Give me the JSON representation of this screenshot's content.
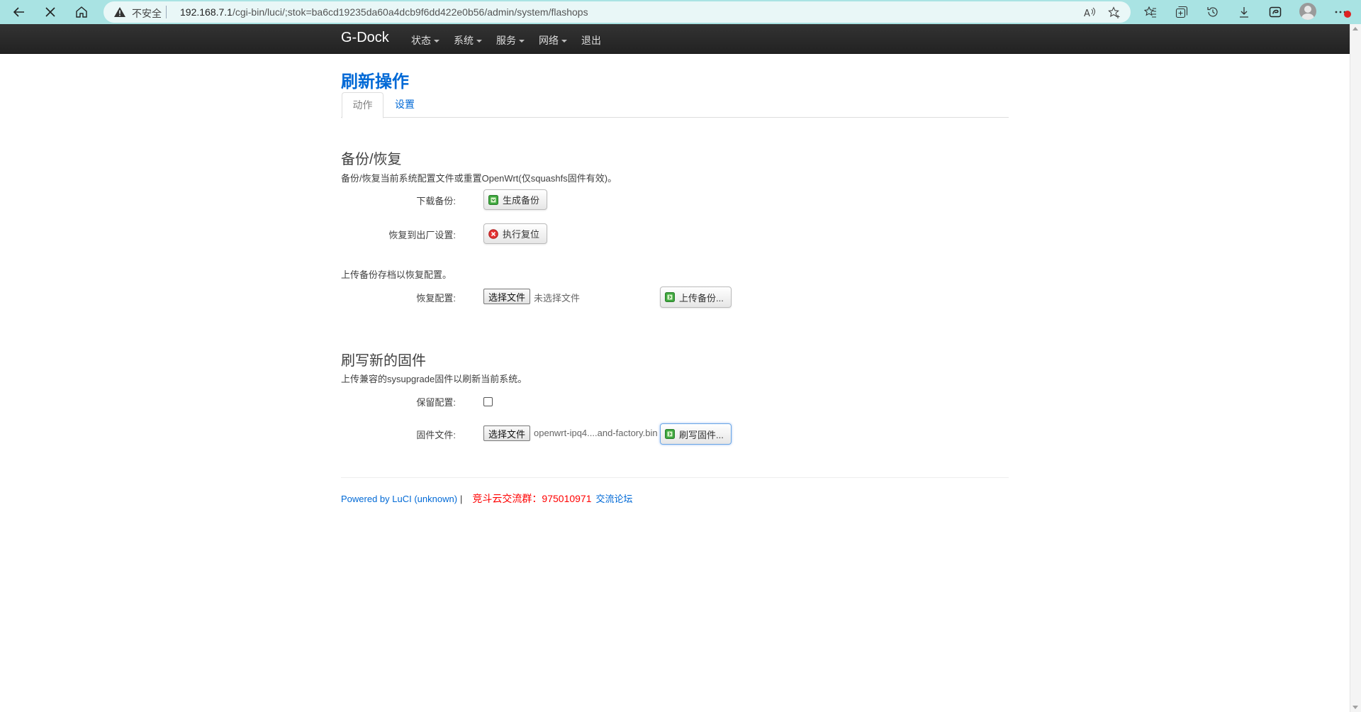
{
  "browser": {
    "insecure_label": "不安全",
    "url_host": "192.168.7.1",
    "url_path": "/cgi-bin/luci/;stok=ba6cd19235da60a4dcb9f6dd422e0b56/admin/system/flashops"
  },
  "navbar": {
    "brand": "G-Dock",
    "menu": [
      {
        "label": "状态"
      },
      {
        "label": "系统"
      },
      {
        "label": "服务"
      },
      {
        "label": "网络"
      },
      {
        "label": "退出"
      }
    ]
  },
  "page": {
    "title": "刷新操作",
    "tabs": [
      {
        "label": "动作"
      },
      {
        "label": "设置"
      }
    ]
  },
  "backup": {
    "title": "备份/恢复",
    "description": "备份/恢复当前系统配置文件或重置OpenWrt(仅squashfs固件有效)。",
    "download_label": "下载备份:",
    "generate_button": "生成备份",
    "reset_label": "恢复到出厂设置:",
    "reset_button": "执行复位",
    "upload_description": "上传备份存档以恢复配置。",
    "restore_label": "恢复配置:",
    "choose_file": "选择文件",
    "no_file": "未选择文件",
    "upload_button": "上传备份..."
  },
  "flash": {
    "title": "刷写新的固件",
    "description": "上传兼容的sysupgrade固件以刷新当前系统。",
    "keep_label": "保留配置:",
    "keep_checked": false,
    "firmware_label": "固件文件:",
    "choose_file": "选择文件",
    "file_name": "openwrt-ipq4....and-factory.bin",
    "flash_button": "刷写固件..."
  },
  "footer": {
    "powered_by": "Powered by LuCI (unknown)",
    "separator": "|",
    "qq_group": "竞斗云交流群：975010971",
    "forum_link": "交流论坛"
  }
}
